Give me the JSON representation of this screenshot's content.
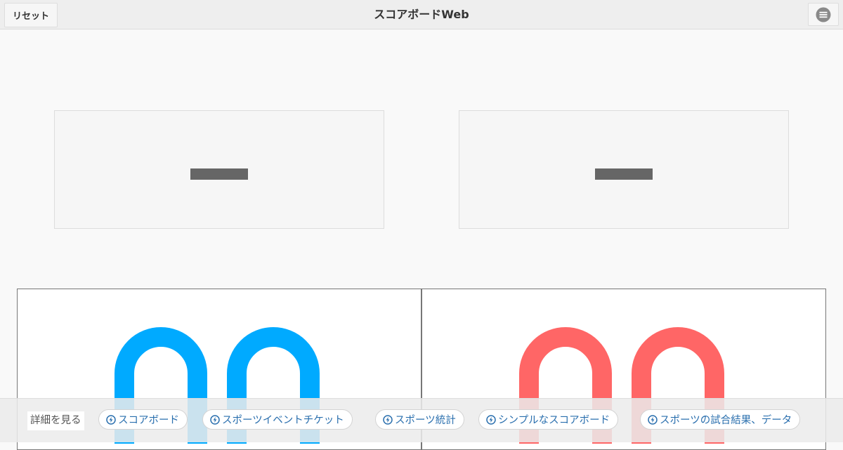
{
  "header": {
    "reset_label": "リセット",
    "title": "スコアボードWeb",
    "menu_icon": "menu-icon"
  },
  "teams": [
    {
      "name": "—",
      "score": "00",
      "color": "#00aaff"
    },
    {
      "name": "—",
      "score": "00",
      "color": "#ff6666"
    }
  ],
  "footer": {
    "details_label": "詳細を見る",
    "links": [
      {
        "label": "スコアボード",
        "icon": "bolt-circle-icon"
      },
      {
        "label": "スポーツイベントチケット",
        "icon": "bolt-circle-icon"
      },
      {
        "label": "スポーツ統計",
        "icon": "bolt-circle-icon"
      },
      {
        "label": "シンプルなスコアボード",
        "icon": "bolt-circle-icon"
      },
      {
        "label": "スポーツの試合結果、データ",
        "icon": "bolt-circle-icon"
      }
    ]
  },
  "colors": {
    "link": "#2a6fae",
    "home": "#00aaff",
    "away": "#ff6666"
  }
}
